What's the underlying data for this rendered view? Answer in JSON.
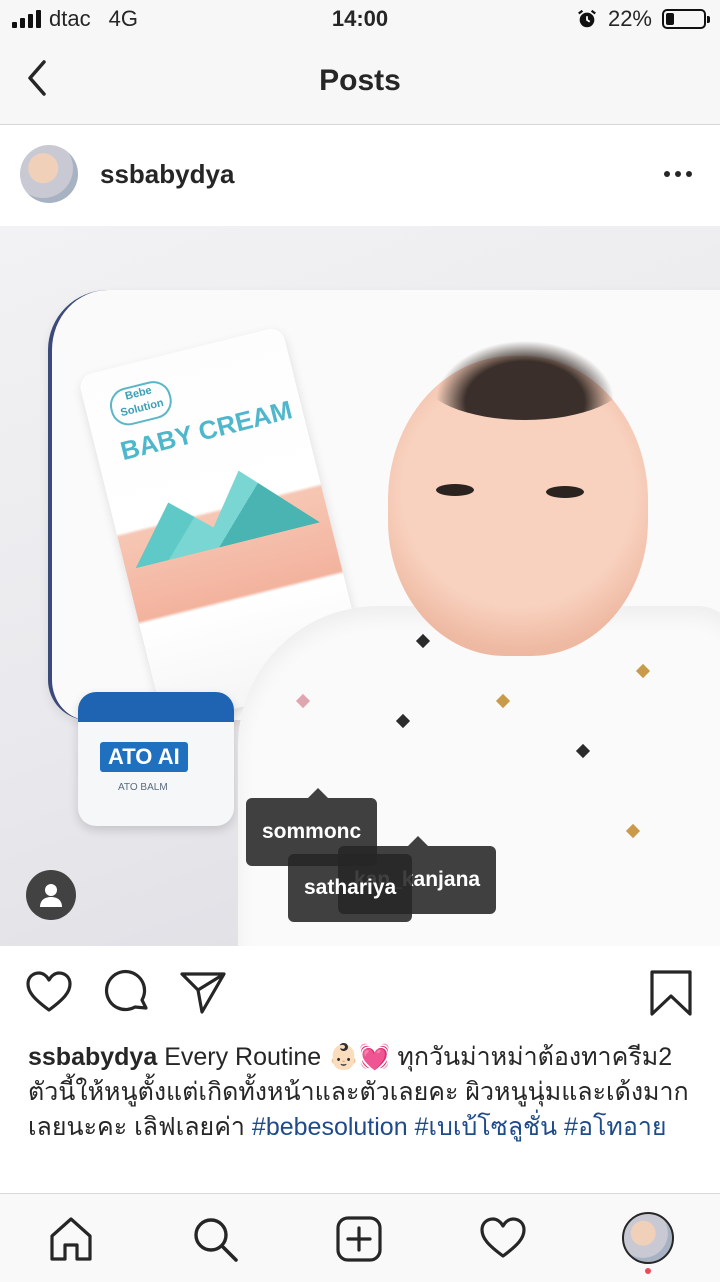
{
  "status_bar": {
    "carrier": "dtac",
    "network": "4G",
    "time": "14:00",
    "battery": "22%",
    "battery_level": 0.22,
    "alarm_icon": "alarm-icon"
  },
  "nav": {
    "title": "Posts",
    "back_icon": "chevron-left-icon"
  },
  "post": {
    "username": "ssbabydya",
    "more_icon": "more-horizontal-icon",
    "tags": [
      "sommonc",
      "kan_kanjana",
      "sathariya"
    ],
    "user_tag_icon": "user-tags-icon",
    "product_text": {
      "tube_brand": "Bebe Solution",
      "tube_name": "BABY CREAM",
      "jar_name": "ATO AI",
      "jar_sub": "ATO BALM"
    },
    "actions": {
      "like_icon": "heart-icon",
      "comment_icon": "comment-icon",
      "share_icon": "send-icon",
      "save_icon": "bookmark-icon"
    },
    "caption": {
      "username": "ssbabydya",
      "text": " Every Routine 👶🏻💓 ทุกวันม่าหม่าต้องทาครีม2 ตัวนี้ให้หนูตั้งแต่เกิดทั้งหน้าและตัวเลยคะ ผิวหนูนุ่มและเด้งมากเลยนะคะ เลิฟเลยค่า ",
      "hashtags": [
        "#bebesolution",
        "#เบเบ้โซลูชั่น",
        "#อโทอาย"
      ]
    }
  },
  "tab_bar": {
    "items": [
      "home-icon",
      "search-icon",
      "new-post-icon",
      "activity-heart-icon",
      "profile-avatar"
    ]
  }
}
